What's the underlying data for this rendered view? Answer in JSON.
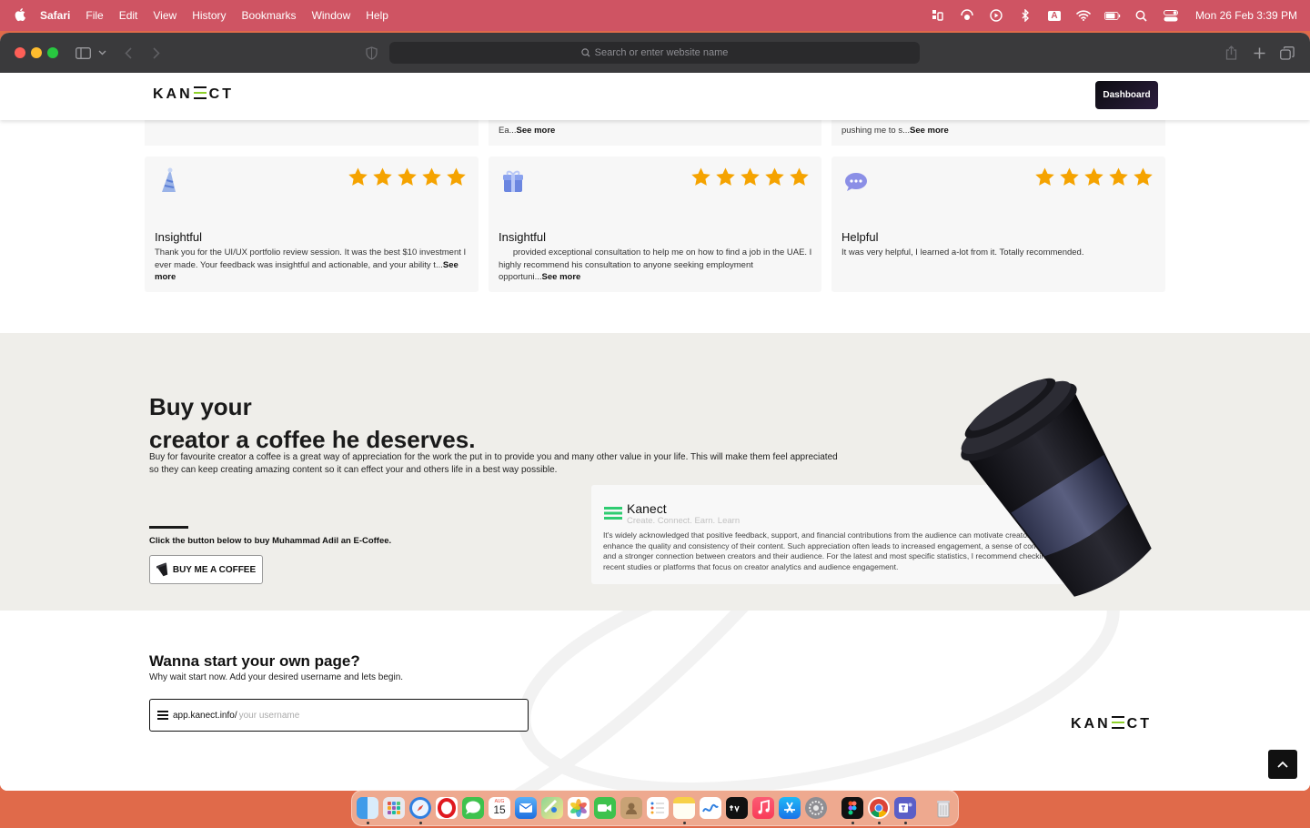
{
  "menubar": {
    "app": "Safari",
    "items": [
      "File",
      "Edit",
      "View",
      "History",
      "Bookmarks",
      "Window",
      "Help"
    ],
    "input_indicator": "A",
    "clock": "Mon 26 Feb  3:39 PM"
  },
  "browser": {
    "search_placeholder": "Search or enter website name"
  },
  "site": {
    "logo": {
      "left": "KAN",
      "right": "CT",
      "accent": "#8ed12a"
    },
    "dashboard_label": "Dashboard"
  },
  "reviews_top": [
    {
      "text_tail": "Ea...",
      "more": "See more"
    },
    {
      "text_tail": "pushing me to s...",
      "more": "See more"
    }
  ],
  "reviews": [
    {
      "title": "Insightful",
      "stars": 5,
      "icon": "party-hat-icon",
      "text": "Thank you for the UI/UX portfolio review session. It was the best $10 investment I ever made. Your feedback was insightful and actionable, and your ability t...",
      "more": "See more"
    },
    {
      "title": "Insightful",
      "stars": 5,
      "icon": "gift-icon",
      "text": "      provided exceptional consultation to help me on how to find a job in the UAE. I highly recommend his consultation to anyone seeking employment opportuni...",
      "more": "See more"
    },
    {
      "title": "Helpful",
      "stars": 5,
      "icon": "chat-bubble-icon",
      "text": "It was very helpful, I learned a-lot from it. Totally recommended.",
      "more": ""
    }
  ],
  "coffee": {
    "heading_line1": "Buy your",
    "heading_line2": "creator a coffee he deserves.",
    "description": "Buy for favourite creator a coffee is a great way of appreciation for the work the put in to provide you and many other value in your life. This will make them feel appreciated so they can keep creating amazing content so it can effect your and others life in a best way possible.",
    "cta_text": "Click the button below to buy Muhammad Adil an E-Coffee.",
    "button_label": "BUY ME A COFFEE",
    "card": {
      "name": "Kanect",
      "tagline": "Create. Connect. Earn. Learn",
      "body": "It's widely acknowledged that positive feedback, support, and financial contributions from the audience can motivate creators to enhance the quality and consistency of their content. Such appreciation often leads to increased engagement, a sense of community, and a stronger connection between creators and their audience. For the latest and most specific statistics, I recommend checking recent studies or platforms that focus on creator analytics and audience engagement."
    }
  },
  "start_page": {
    "heading": "Wanna start your own page?",
    "subheading": "Why wait start now. Add your desired username and lets begin.",
    "url_prefix": "app.kanect.info/",
    "username_placeholder": "your username"
  },
  "colors": {
    "star": "#f5a300",
    "menubar": "#cf5463",
    "accent": "#8ed12a"
  },
  "dock": {
    "apps": [
      "finder",
      "launchpad",
      "safari",
      "opera",
      "messages",
      "calendar",
      "mail",
      "maps",
      "photos",
      "facetime",
      "contacts",
      "reminders",
      "notes",
      "freeform",
      "tv",
      "music",
      "app-store",
      "system-settings",
      "figma",
      "chrome",
      "teams",
      "trash"
    ],
    "calendar_month": "AUG",
    "calendar_day": "15"
  }
}
